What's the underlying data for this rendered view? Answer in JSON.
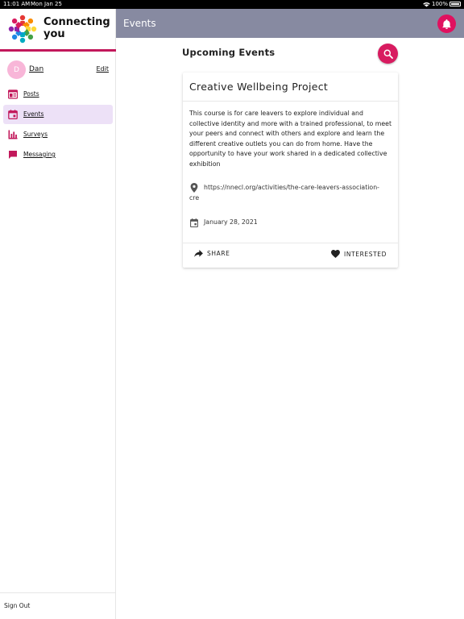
{
  "status_bar": {
    "time": "11:01 AM",
    "date": "Mon Jan 25",
    "battery": "100%"
  },
  "app": {
    "name_line1": "Connecting",
    "name_line2": "you",
    "brand_color": "#c2185b",
    "accent_color": "#d81b60"
  },
  "user": {
    "initial": "D",
    "name": "Dan",
    "edit_label": "Edit"
  },
  "nav": {
    "items": [
      {
        "label": "Posts",
        "icon": "posts-icon",
        "active": false
      },
      {
        "label": "Events",
        "icon": "calendar-icon",
        "active": true
      },
      {
        "label": "Surveys",
        "icon": "bar-chart-icon",
        "active": false
      },
      {
        "label": "Messaging",
        "icon": "chat-icon",
        "active": false
      }
    ],
    "sign_out": "Sign Out"
  },
  "header": {
    "title": "Events",
    "bar_color": "#878aa1"
  },
  "main": {
    "section_title": "Upcoming Events",
    "event": {
      "title": "Creative Wellbeing Project",
      "description": "This course is for care leavers to explore individual and collective identity and more with a trained professional, to meet your peers and connect with others and explore and learn the different creative outlets you can do from home. Have the opportunity to have your work shared in a dedicated collective exhibition",
      "link": "https://nnecl.org/activities/the-care-leavers-association-cre",
      "date": "January 28, 2021",
      "share_label": "SHARE",
      "interested_label": "INTERESTED"
    }
  }
}
